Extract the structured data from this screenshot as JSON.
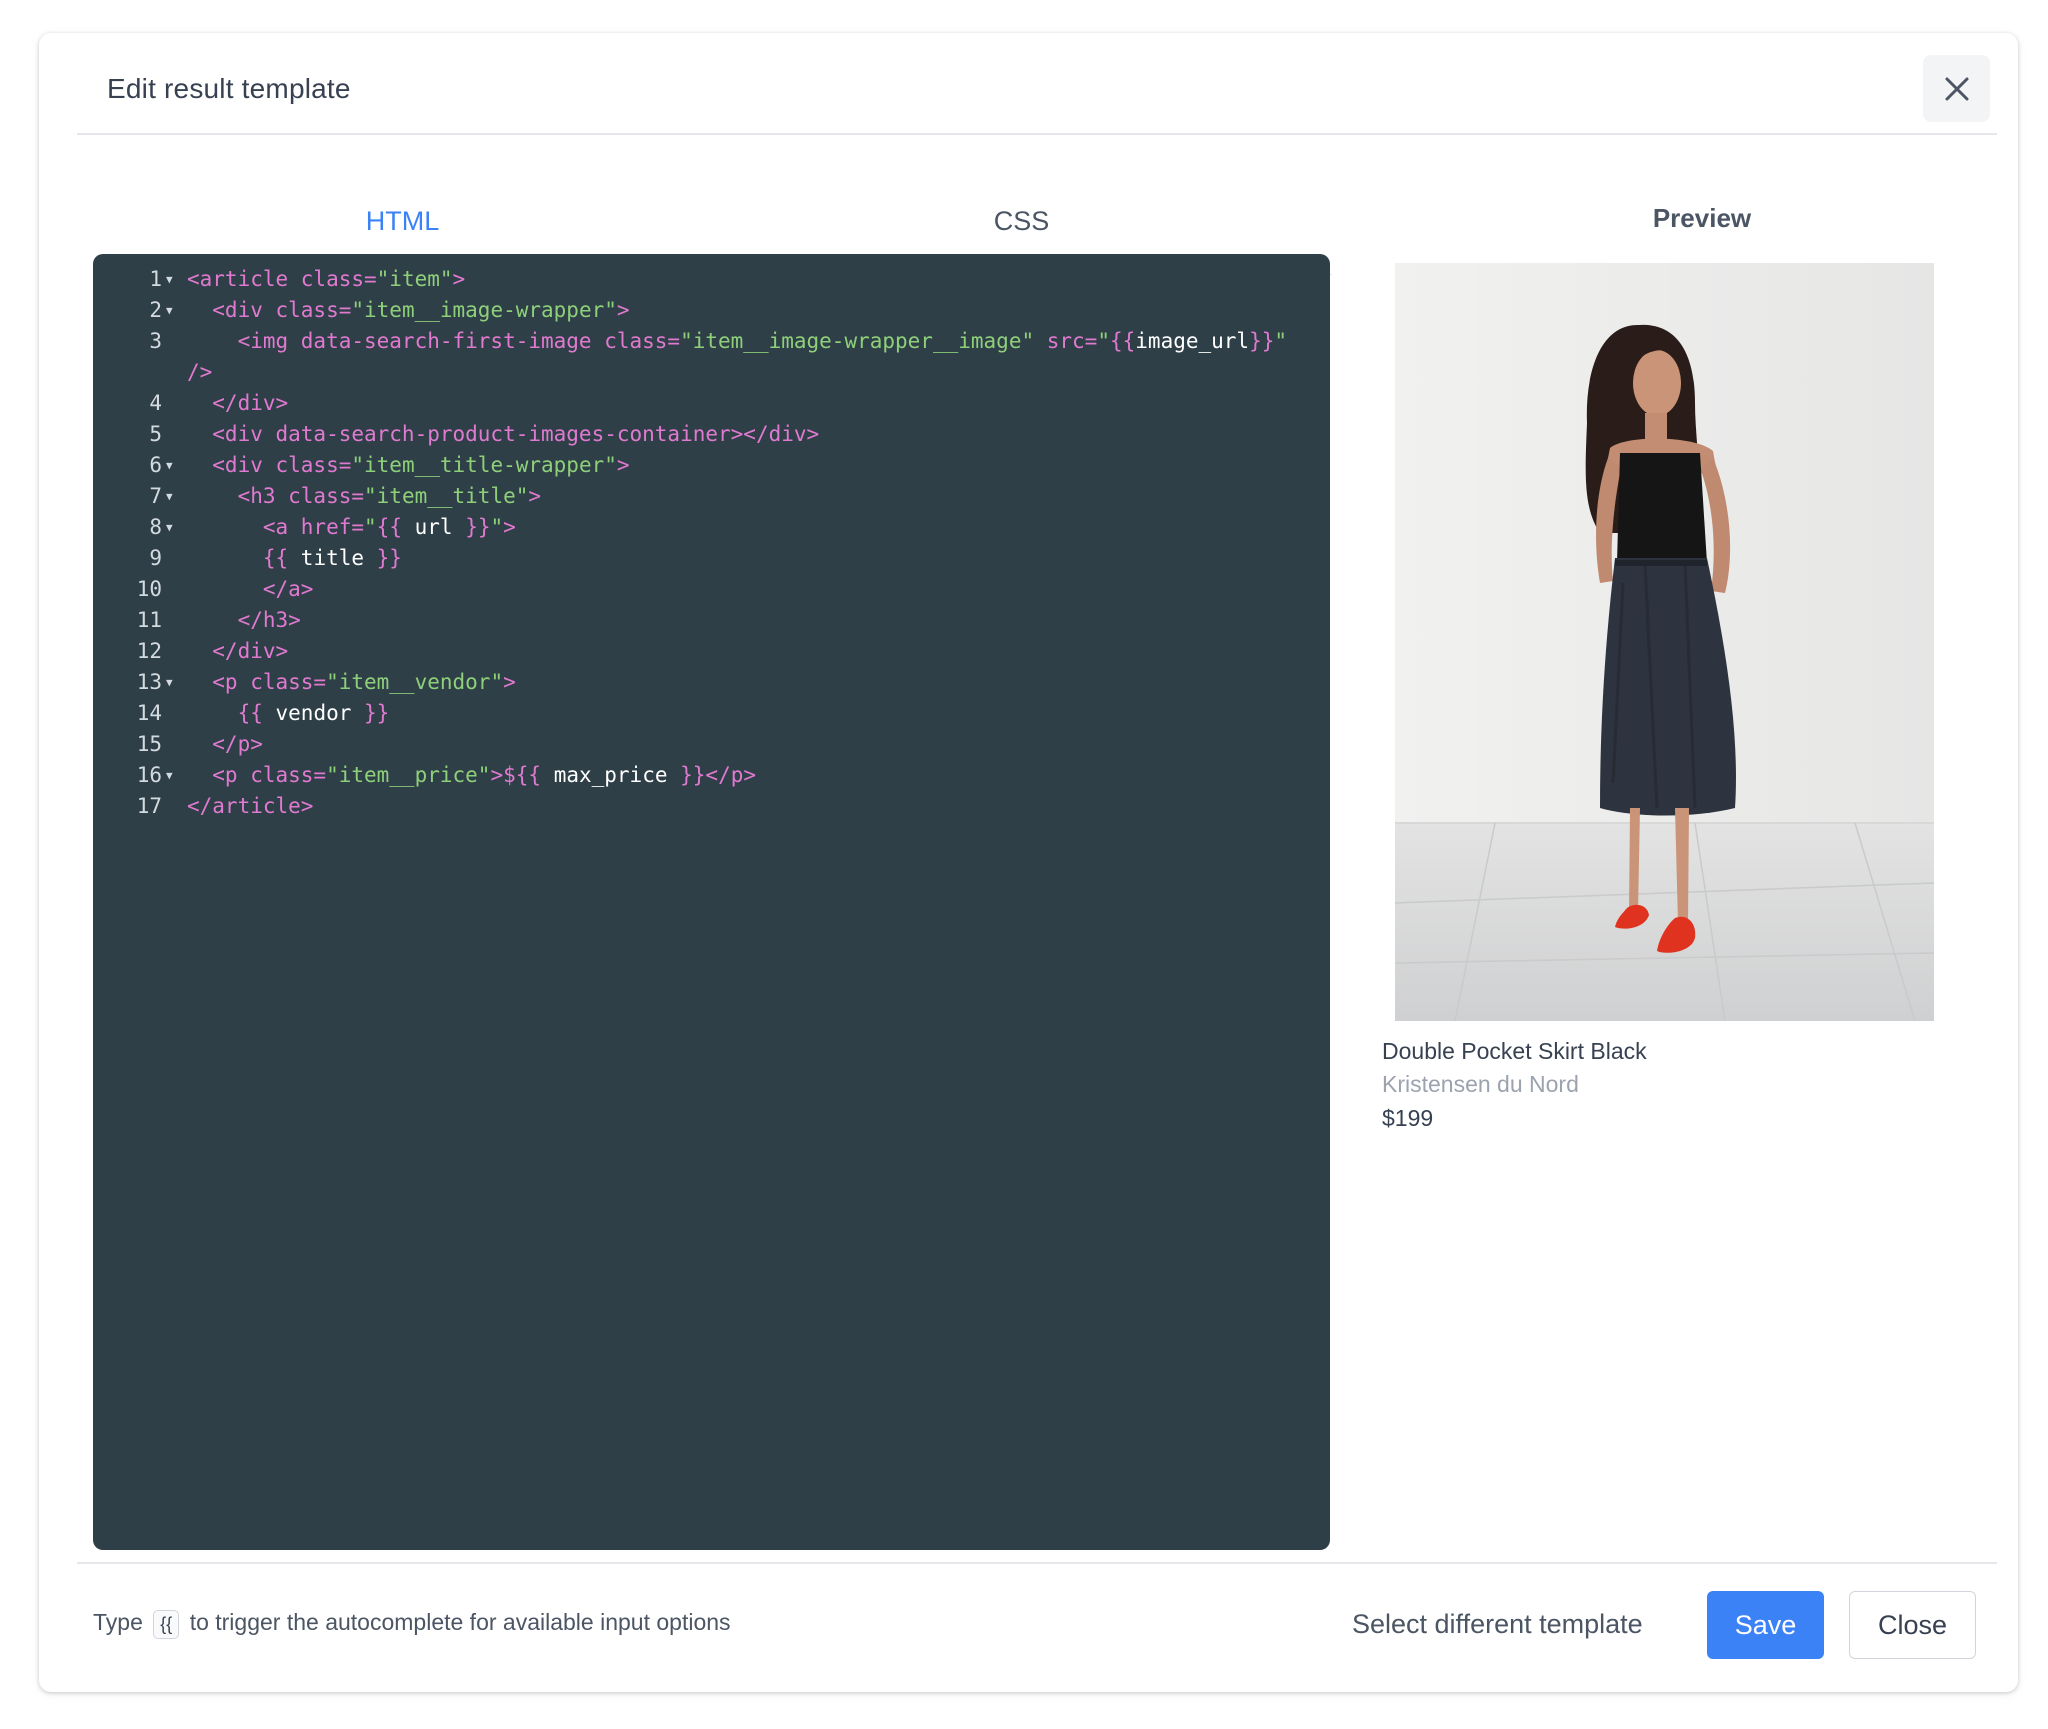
{
  "modal": {
    "title": "Edit result template",
    "close_icon": "close-icon"
  },
  "tabs": [
    {
      "label": "HTML",
      "active": true
    },
    {
      "label": "CSS",
      "active": false
    }
  ],
  "editor": {
    "lines": [
      {
        "num": "1",
        "fold": true
      },
      {
        "num": "2",
        "fold": true
      },
      {
        "num": "3",
        "fold": false
      },
      {
        "num": "",
        "fold": false
      },
      {
        "num": "4",
        "fold": false
      },
      {
        "num": "5",
        "fold": false
      },
      {
        "num": "6",
        "fold": true
      },
      {
        "num": "7",
        "fold": true
      },
      {
        "num": "8",
        "fold": true
      },
      {
        "num": "9",
        "fold": false
      },
      {
        "num": "10",
        "fold": false
      },
      {
        "num": "11",
        "fold": false
      },
      {
        "num": "12",
        "fold": false
      },
      {
        "num": "13",
        "fold": true
      },
      {
        "num": "14",
        "fold": false
      },
      {
        "num": "15",
        "fold": false
      },
      {
        "num": "16",
        "fold": true
      },
      {
        "num": "17",
        "fold": false
      }
    ],
    "code": [
      "<article class=\"item\">",
      "  <div class=\"item__image-wrapper\">",
      "    <img data-search-first-image class=\"item__image-wrapper__image\" src=\"{{image_url}}\"",
      "/>",
      "  </div>",
      "  <div data-search-product-images-container></div>",
      "  <div class=\"item__title-wrapper\">",
      "    <h3 class=\"item__title\">",
      "      <a href=\"{{ url }}\">",
      "      {{ title }}",
      "      </a>",
      "    </h3>",
      "  </div>",
      "  <p class=\"item__vendor\">",
      "    {{ vendor }}",
      "  </p>",
      "  <p class=\"item__price\">${{ max_price }}</p>",
      "</article>"
    ]
  },
  "preview": {
    "heading": "Preview",
    "image_alt": "Woman wearing a black sleeveless top, dark wrap skirt and red sandals",
    "product_title": "Double Pocket Skirt Black",
    "vendor": "Kristensen du Nord",
    "price": "$199"
  },
  "footer": {
    "hint_prefix": "Type",
    "hint_key": "{{",
    "hint_suffix": "to trigger the autocomplete for available input options",
    "select_template_label": "Select different template",
    "save_label": "Save",
    "close_label": "Close"
  },
  "colors": {
    "accent": "#3b82f6",
    "editor_bg": "#2f3f48",
    "code_tag": "#e07ad0",
    "code_string": "#8ed07a",
    "code_text": "#ffffff"
  }
}
